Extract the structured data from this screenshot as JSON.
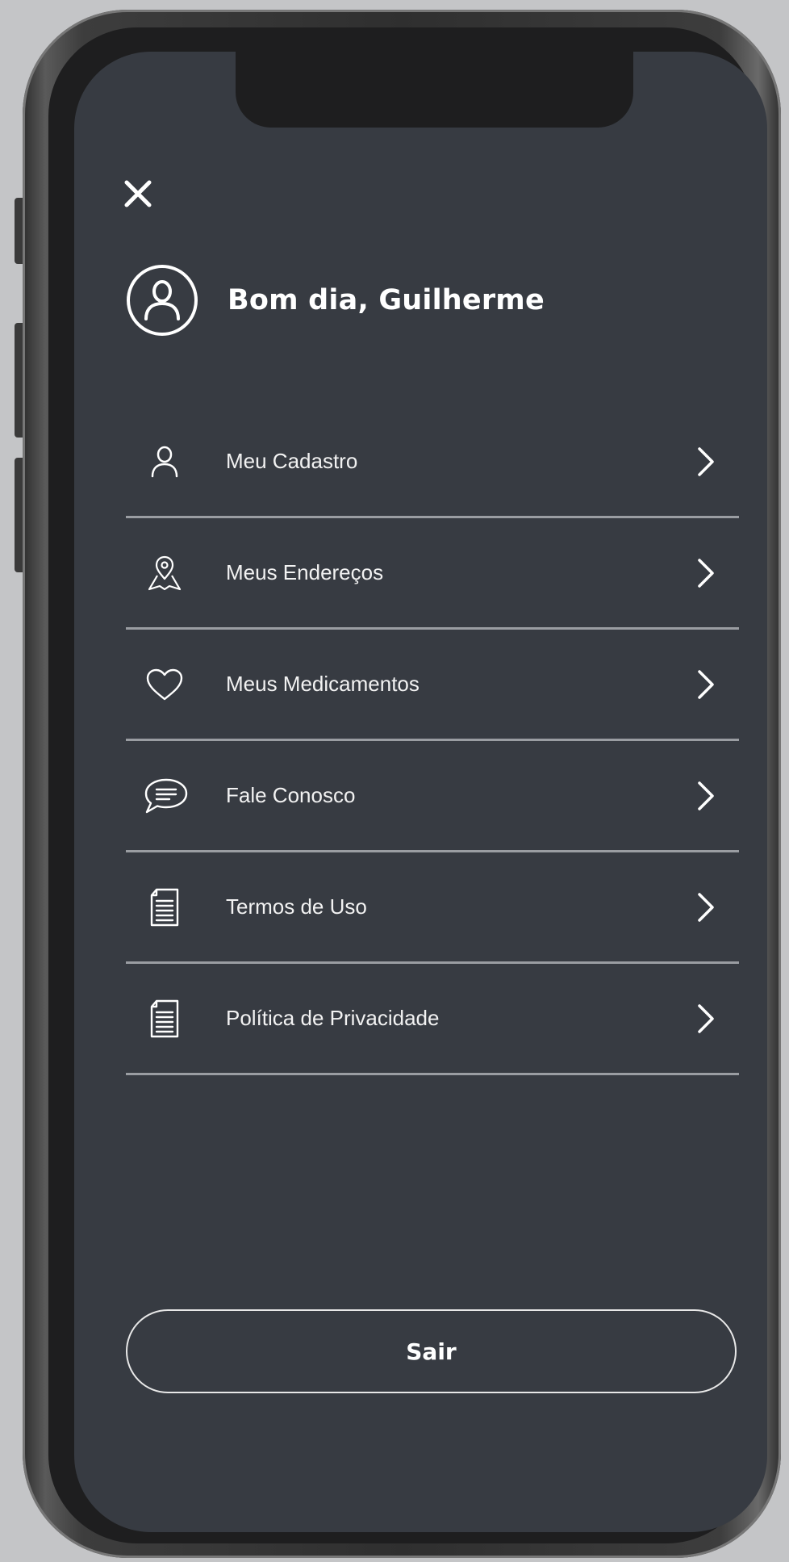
{
  "header": {
    "greeting": "Bom dia, Guilherme",
    "close_icon": "close-icon",
    "avatar_icon": "user-circle-icon"
  },
  "menu": {
    "items": [
      {
        "label": "Meu Cadastro",
        "icon": "user-icon"
      },
      {
        "label": "Meus Endereços",
        "icon": "map-pin-icon"
      },
      {
        "label": "Meus Medicamentos",
        "icon": "heart-icon"
      },
      {
        "label": "Fale Conosco",
        "icon": "chat-bubble-icon"
      },
      {
        "label": "Termos de Uso",
        "icon": "document-icon"
      },
      {
        "label": "Política de Privacidade",
        "icon": "document-icon"
      }
    ]
  },
  "footer": {
    "logout_label": "Sair"
  },
  "colors": {
    "screen_background": "#373b42",
    "text": "#ffffff",
    "divider": "#9a9da2",
    "page_background": "#c4c5c7"
  }
}
